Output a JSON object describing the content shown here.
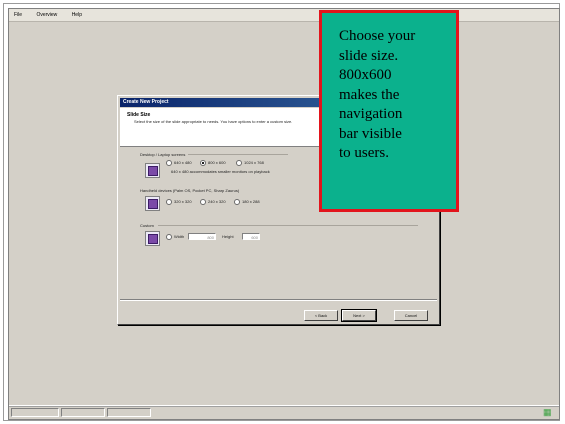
{
  "menubar": {
    "items": [
      "File",
      "Overview",
      "Help"
    ]
  },
  "dialog": {
    "title": "Create New Project",
    "header_title": "Slide Size",
    "header_desc": "Select the size of the slide appropriate to needs. You have options to enter a custom size.",
    "desktop": {
      "label": "Desktop / Laptop screens",
      "options": [
        "640 x 480",
        "800 x 600",
        "1024 x 768"
      ],
      "selected": "800 x 600",
      "note": "640 x 480 accommodates smaller monitors on playback"
    },
    "handheld": {
      "label": "Handheld devices (Palm OS, Pocket PC, Sharp Zaurus)",
      "options": [
        "320 x 320",
        "240 x 320",
        "180 x 288"
      ]
    },
    "custom": {
      "label": "Custom",
      "width_label": "Width",
      "height_label": "Height",
      "width_value": "800",
      "height_value": "600"
    },
    "buttons": {
      "back": "< Back",
      "next": "Next >",
      "cancel": "Cancel"
    }
  },
  "callout": {
    "lines": [
      "Choose your",
      "slide size.",
      "800x600",
      "makes the",
      "navigation",
      "bar visible",
      "to users."
    ],
    "bg_color": "#0bb18d",
    "border_color": "#e2141c"
  }
}
